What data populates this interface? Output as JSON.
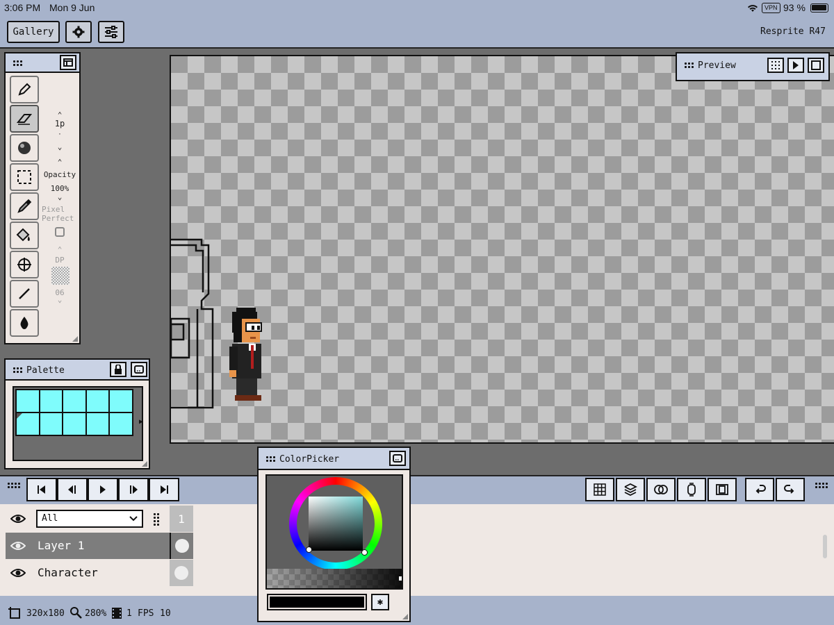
{
  "status": {
    "time": "3:06 PM",
    "date": "Mon 9 Jun",
    "vpn": "VPN",
    "battery": "93 %"
  },
  "topbar": {
    "gallery_label": "Gallery",
    "app_version": "Resprite R47"
  },
  "tools": {
    "brush_size": "1p",
    "opacity_label": "Opacity",
    "opacity_value": "100%",
    "pixel_perfect_label_1": "Pixel",
    "pixel_perfect_label_2": "Perfect",
    "dither_label": "DP",
    "dither_value": "06"
  },
  "preview": {
    "title": "Preview"
  },
  "palette": {
    "title": "Palette",
    "swatch_color": "#7ffcfc"
  },
  "colorpicker": {
    "title": "ColorPicker",
    "current_color": "#000000"
  },
  "layers": {
    "filter_value": "All",
    "frame_number": "1",
    "items": [
      {
        "name": "Layer 1",
        "selected": true
      },
      {
        "name": "Character",
        "selected": false
      }
    ]
  },
  "footer": {
    "canvas_size": "320x180",
    "zoom": "280%",
    "frames": "1",
    "fps_label": "FPS",
    "fps_value": "10"
  }
}
